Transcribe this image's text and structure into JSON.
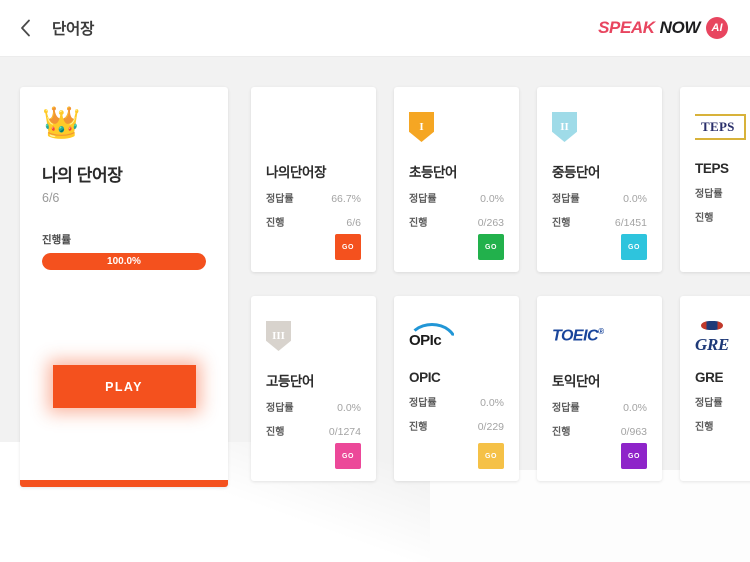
{
  "header": {
    "back_icon": "chevron-left-icon",
    "title": "단어장",
    "brand": {
      "speak": "SPEAK",
      "now": "NOW",
      "ai": "AI",
      "accent_color": "#e8455f"
    }
  },
  "featured": {
    "icon": "crown-icon",
    "crown_glyph": "👑",
    "title": "나의 단어장",
    "count": "6/6",
    "progress_label": "진행률",
    "progress_value": "100.0%",
    "progress_percent": 100,
    "play_label": "PLAY",
    "accent_color": "#f4511e"
  },
  "stat_keys": {
    "accuracy": "정답률",
    "progress": "진행"
  },
  "go_label": "GO",
  "cards": [
    {
      "name": "나의단어장",
      "logo": "none",
      "accuracy": "66.7%",
      "progress": "6/6",
      "go_color": "#f4511e",
      "card_id": "my-wordbook"
    },
    {
      "name": "초등단어",
      "logo": "shield-level-1-icon",
      "shield_text": "I",
      "shield_color": "#f5a623",
      "accuracy": "0.0%",
      "progress": "0/263",
      "go_color": "#22b14c",
      "card_id": "elementary"
    },
    {
      "name": "중등단어",
      "logo": "shield-level-2-icon",
      "shield_text": "II",
      "shield_color": "#9fdbe8",
      "accuracy": "0.0%",
      "progress": "6/1451",
      "go_color": "#2ec4dd",
      "card_id": "middle-school"
    },
    {
      "name": "TEPS",
      "logo": "teps-logo",
      "logo_text": "TEPS",
      "accuracy": "정답률",
      "progress": "진행",
      "go_color": "",
      "card_id": "teps",
      "clipped": true
    },
    {
      "name": "고등단어",
      "logo": "shield-level-3-icon",
      "shield_text": "III",
      "shield_color": "#d8d3cd",
      "accuracy": "0.0%",
      "progress": "0/1274",
      "go_color": "#ec4899",
      "card_id": "high-school"
    },
    {
      "name": "OPIC",
      "logo": "opic-logo",
      "logo_text": "OPIc",
      "accuracy": "0.0%",
      "progress": "0/229",
      "go_color": "#f5c147",
      "card_id": "opic"
    },
    {
      "name": "토익단어",
      "logo": "toeic-logo",
      "logo_text": "TOEIC",
      "accuracy": "0.0%",
      "progress": "0/963",
      "go_color": "#8e24c9",
      "card_id": "toeic"
    },
    {
      "name": "GRE",
      "logo": "gre-logo",
      "logo_text": "GRE",
      "accuracy": "정답률",
      "progress": "진행",
      "go_color": "",
      "card_id": "gre",
      "clipped": true
    }
  ]
}
